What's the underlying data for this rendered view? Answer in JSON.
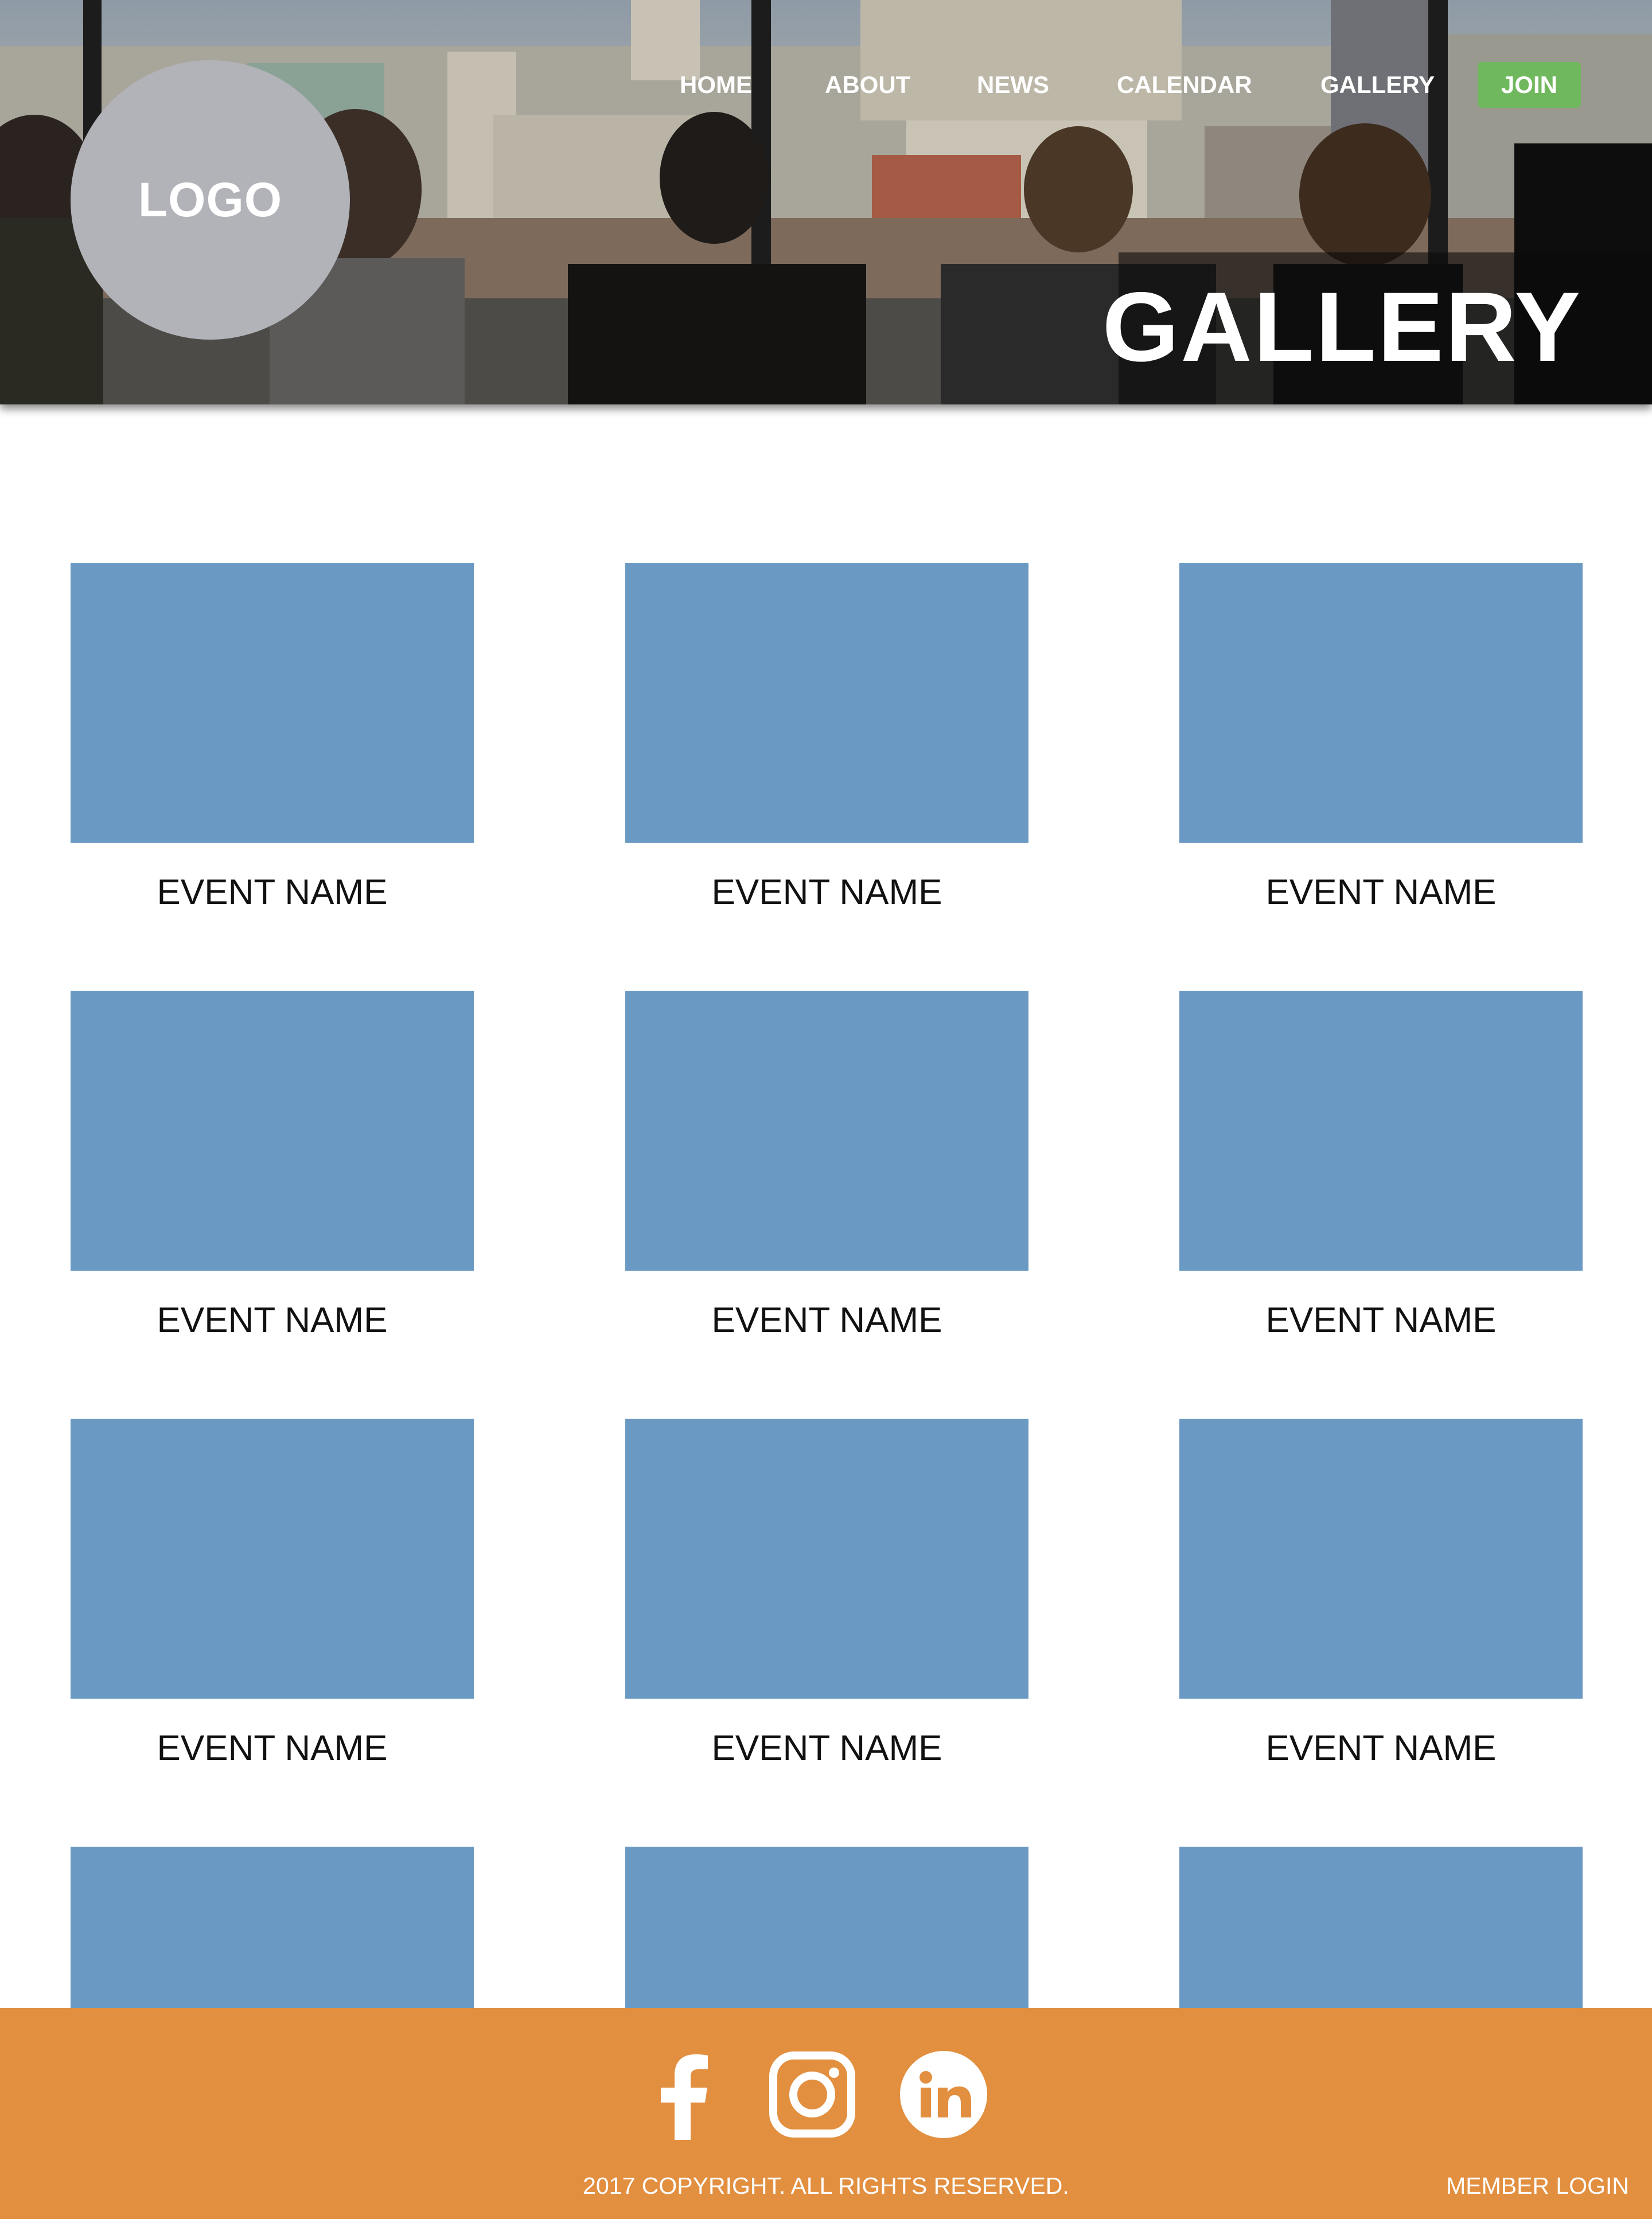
{
  "brand": {
    "logo_text": "LOGO"
  },
  "nav": {
    "items": [
      {
        "label": "HOME"
      },
      {
        "label": "ABOUT"
      },
      {
        "label": "NEWS"
      },
      {
        "label": "CALENDAR"
      },
      {
        "label": "GALLERY"
      }
    ],
    "join_label": "JOIN"
  },
  "hero": {
    "title": "GALLERY"
  },
  "gallery": {
    "items": [
      {
        "caption": "EVENT NAME"
      },
      {
        "caption": "EVENT NAME"
      },
      {
        "caption": "EVENT NAME"
      },
      {
        "caption": "EVENT NAME"
      },
      {
        "caption": "EVENT NAME"
      },
      {
        "caption": "EVENT NAME"
      },
      {
        "caption": "EVENT NAME"
      },
      {
        "caption": "EVENT NAME"
      },
      {
        "caption": "EVENT NAME"
      },
      {
        "caption": ""
      },
      {
        "caption": ""
      },
      {
        "caption": ""
      }
    ]
  },
  "footer": {
    "social_icons": [
      "facebook-icon",
      "instagram-icon",
      "linkedin-icon"
    ],
    "copyright": "2017 COPYRIGHT. ALL RIGHTS RESERVED.",
    "member_login": "MEMBER LOGIN"
  },
  "colors": {
    "placeholder_blue": "#6a9ac3",
    "join_green": "#6fb85d",
    "footer_orange": "#e28f40",
    "logo_gray": "#b2b3b8"
  }
}
